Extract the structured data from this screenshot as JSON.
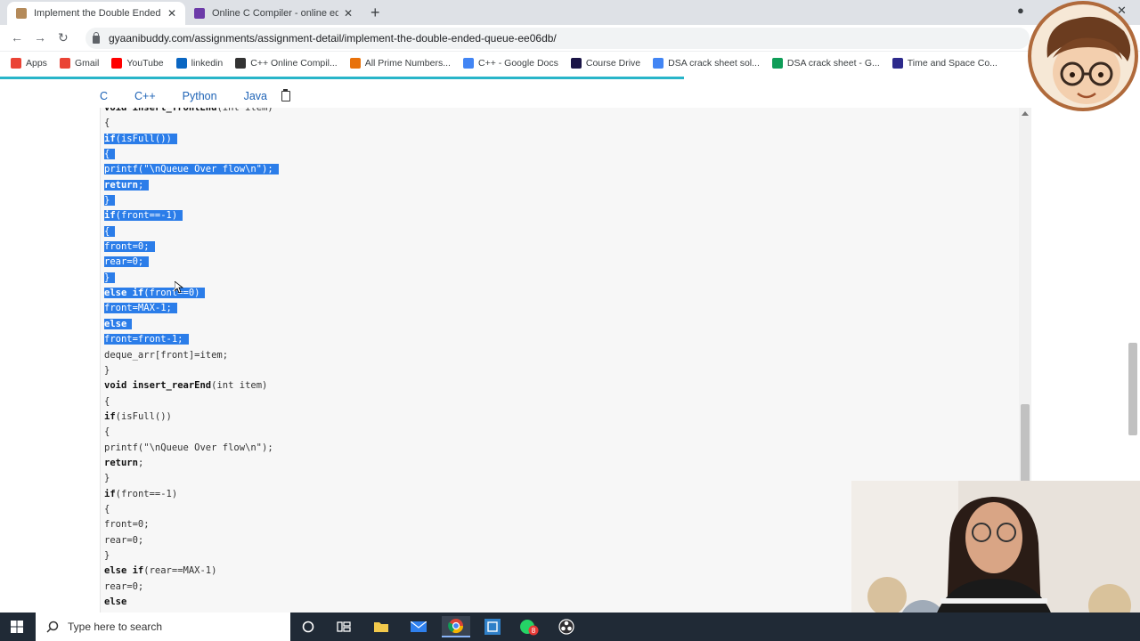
{
  "browser": {
    "tabs": [
      {
        "title": "Implement the Double Ended Qu",
        "active": true
      },
      {
        "title": "Online C Compiler - online editor",
        "active": false
      }
    ],
    "url": "gyaanibuddy.com/assignments/assignment-detail/implement-the-double-ended-queue-ee06db/"
  },
  "bookmarks": [
    {
      "label": "Apps",
      "color": "#ea4335"
    },
    {
      "label": "Gmail",
      "color": "#ea4335"
    },
    {
      "label": "YouTube",
      "color": "#ff0000"
    },
    {
      "label": "linkedin",
      "color": "#0a66c2"
    },
    {
      "label": "C++ Online Compil...",
      "color": "#333333"
    },
    {
      "label": "All Prime Numbers...",
      "color": "#e8710a"
    },
    {
      "label": "C++ - Google Docs",
      "color": "#4285f4"
    },
    {
      "label": "Course Drive",
      "color": "#1a1446"
    },
    {
      "label": "DSA crack sheet sol...",
      "color": "#4285f4"
    },
    {
      "label": "DSA crack sheet - G...",
      "color": "#0f9d58"
    },
    {
      "label": "Time and Space Co...",
      "color": "#2d2a8c"
    }
  ],
  "lang_tabs": [
    "C",
    "C++",
    "Python",
    "Java"
  ],
  "code_lines": [
    {
      "text": "void insert_frontEnd(int item)",
      "sel": false
    },
    {
      "text": "{",
      "sel": false
    },
    {
      "text": "if(isFull())",
      "sel": true
    },
    {
      "text": "{",
      "sel": true
    },
    {
      "text": "printf(\"\\nQueue Over flow\\n\");",
      "sel": true
    },
    {
      "text": "return;",
      "sel": true
    },
    {
      "text": "}",
      "sel": true
    },
    {
      "text": "if(front==-1)",
      "sel": true
    },
    {
      "text": "{",
      "sel": true
    },
    {
      "text": "front=0;",
      "sel": true
    },
    {
      "text": "rear=0;",
      "sel": true
    },
    {
      "text": "}",
      "sel": true
    },
    {
      "text": "else if(front==0)",
      "sel": true
    },
    {
      "text": "front=MAX-1;",
      "sel": true
    },
    {
      "text": "else",
      "sel": true
    },
    {
      "text": "front=front-1;",
      "sel": true
    },
    {
      "text": "deque_arr[front]=item;",
      "sel": false
    },
    {
      "text": "}",
      "sel": false
    },
    {
      "text": "void insert_rearEnd(int item)",
      "sel": false
    },
    {
      "text": "{",
      "sel": false
    },
    {
      "text": "if(isFull())",
      "sel": false
    },
    {
      "text": "{",
      "sel": false
    },
    {
      "text": "printf(\"\\nQueue Over flow\\n\");",
      "sel": false
    },
    {
      "text": "return;",
      "sel": false
    },
    {
      "text": "}",
      "sel": false
    },
    {
      "text": "if(front==-1)",
      "sel": false
    },
    {
      "text": "{",
      "sel": false
    },
    {
      "text": "front=0;",
      "sel": false
    },
    {
      "text": "rear=0;",
      "sel": false
    },
    {
      "text": "}",
      "sel": false
    },
    {
      "text": "else if(rear==MAX-1)",
      "sel": false
    },
    {
      "text": "rear=0;",
      "sel": false
    },
    {
      "text": "else",
      "sel": false
    }
  ],
  "taskbar": {
    "search_placeholder": "Type here to search",
    "whatsapp_badge": "8"
  },
  "colors": {
    "selection": "#2b7de9",
    "link": "#1e63b6",
    "progress": "#28b5c9",
    "taskbar": "#202a36"
  }
}
